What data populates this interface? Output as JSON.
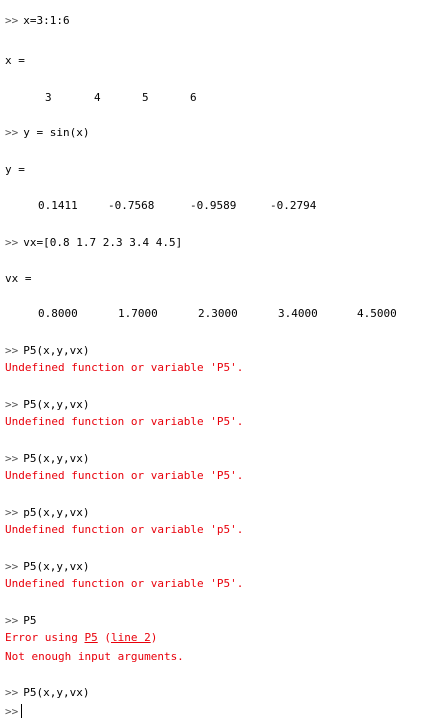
{
  "console": {
    "prompt": ">>",
    "cmd1": "x=3:1:6",
    "x_label": "x =",
    "x_values": [
      "3",
      "4",
      "5",
      "6"
    ],
    "cmd2": "y = sin(x)",
    "y_label": "y =",
    "y_values": [
      "0.1411",
      "-0.7568",
      "-0.9589",
      "-0.2794"
    ],
    "cmd3": "vx=[0.8 1.7 2.3 3.4 4.5]",
    "vx_label": "vx =",
    "vx_values": [
      "0.8000",
      "1.7000",
      "2.3000",
      "3.4000",
      "4.5000"
    ],
    "cmd4": "P5(x,y,vx)",
    "err4": "Undefined function or variable 'P5'.",
    "cmd5": "P5(x,y,vx)",
    "err5": "Undefined function or variable 'P5'.",
    "cmd6": "P5(x,y,vx)",
    "err6": "Undefined function or variable 'P5'.",
    "cmd7": "p5(x,y,vx)",
    "err7": "Undefined function or variable 'p5'.",
    "cmd8": "P5(x,y,vx)",
    "err8": "Undefined function or variable 'P5'.",
    "cmd9": "P5",
    "err9_prefix": "Error using ",
    "err9_fn": "P5",
    "err9_mid": " (",
    "err9_line": "line 2",
    "err9_suffix": ")",
    "err9_msg": "Not enough input arguments.",
    "cmd10": "P5(x,y,vx)",
    "current_input": ""
  }
}
